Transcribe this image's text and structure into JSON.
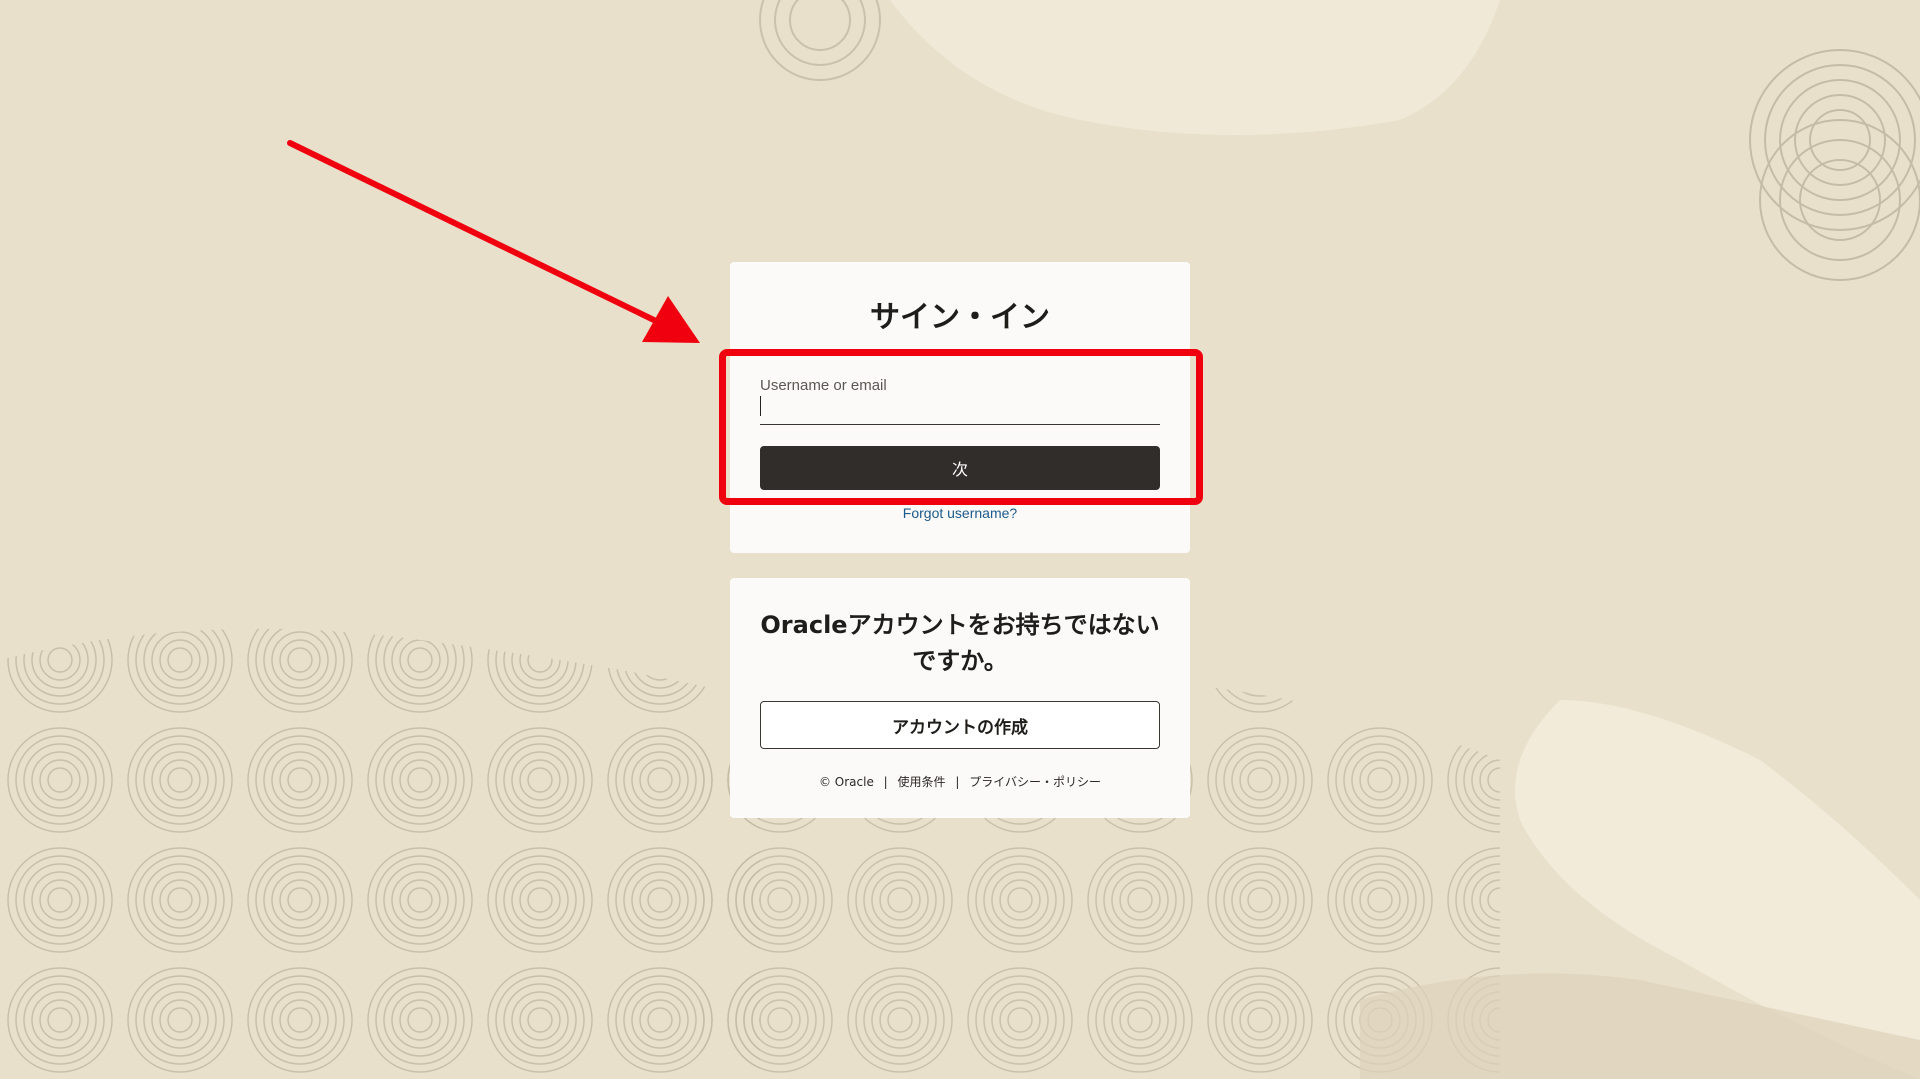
{
  "signin": {
    "title": "サイン・イン",
    "username_label": "Username or email",
    "username_value": "",
    "next_button": "次",
    "forgot_link": "Forgot username?"
  },
  "create_account": {
    "title": "Oracleアカウントをお持ちではないですか。",
    "button": "アカウントの作成"
  },
  "footer": {
    "copyright": "© Oracle",
    "separator": "|",
    "terms": "使用条件",
    "privacy": "プライバシー・ポリシー"
  },
  "annotation": {
    "color": "#f0000f"
  },
  "colors": {
    "background": "#e9e0cb",
    "card": "#fbfaf8",
    "primary_button": "#312d2a",
    "link": "#1c5a8c"
  }
}
